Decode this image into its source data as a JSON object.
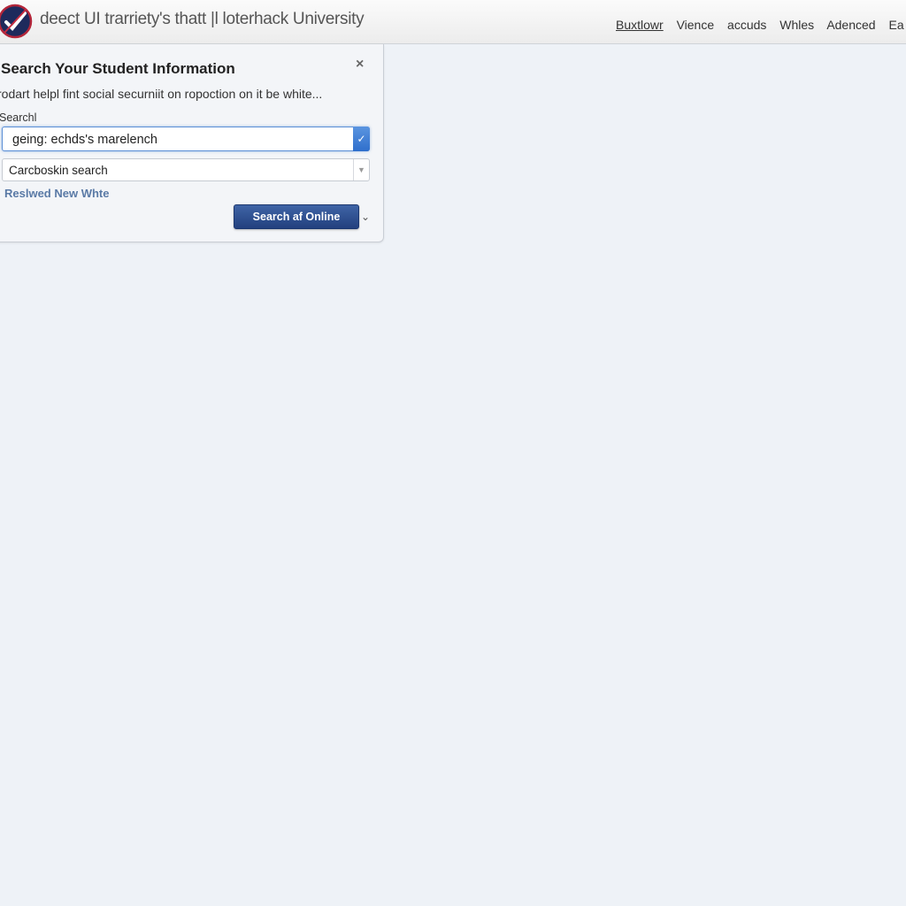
{
  "header": {
    "site_title": "deect UI trarriety's thatt |l loterhack University",
    "nav": [
      "Buxtlowr",
      "Vience",
      "accuds",
      "Whles",
      "Adenced",
      "Ea"
    ],
    "active_nav_index": 0
  },
  "panel": {
    "title": "Search Your Student Information",
    "close_label": "×",
    "description": "rodart helpl fint social securniit on ropoction on it be white...",
    "search_label": "Searchl",
    "search_value": "geing: echds's marelench",
    "search_dropdown_icon": "✓",
    "secondary_value": "Carcboskin search",
    "secondary_dropdown_icon": "▼",
    "link_text": "Reslwed New Whte",
    "primary_button": "Search af Online",
    "chevron_icon": "⌄"
  },
  "colors": {
    "primary": "#2b4a8c",
    "accent": "#3a78d4",
    "link": "#5a7aa6",
    "background": "#eef2f7"
  }
}
